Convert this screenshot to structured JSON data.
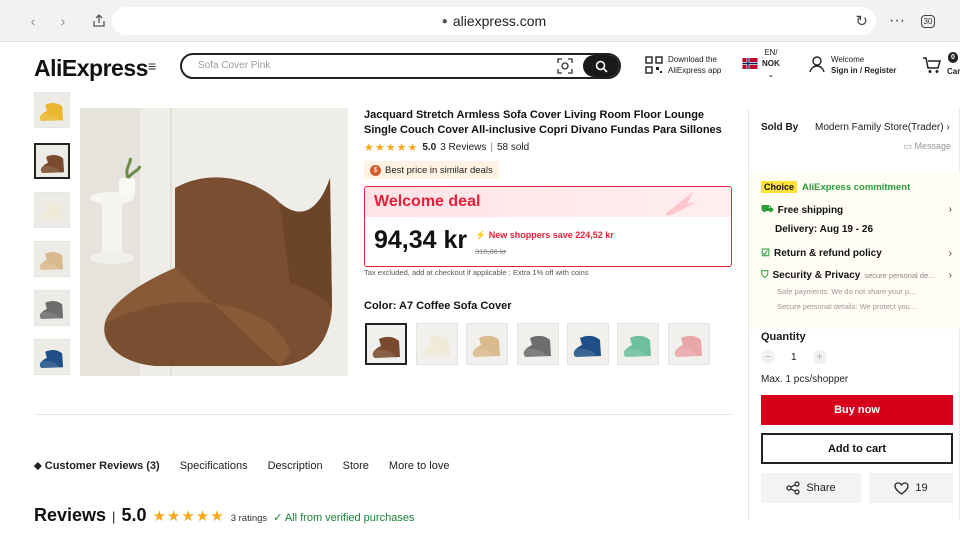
{
  "browser": {
    "url": "aliexpress.com",
    "tab_count": "30"
  },
  "header": {
    "logo_main": "AliExpress",
    "search_placeholder": "Sofa Cover Pink",
    "download_line1": "Download the",
    "download_line2": "AliExpress app",
    "lang": "EN/",
    "currency": "NOK",
    "welcome": "Welcome",
    "signin": "Sign in / Register",
    "cart_count": "0",
    "cart_label": "Car"
  },
  "product": {
    "title": "Jacquard Stretch Armless Sofa Cover Living Room Floor Lounge Single Couch Cover All-inclusive Copri Divano Fundas Para Sillones",
    "stars": "★★★★★",
    "rating": "5.0",
    "reviews_count": "3 Reviews",
    "separator": "|",
    "sold": "58 sold",
    "best_price": "Best price in similar deals",
    "deal_title": "Welcome deal",
    "price": "94,34 kr",
    "save_text": "New shoppers save 224,52 kr",
    "old_price": "318,86 kr",
    "tax_note": "Tax excluded, add at checkout if applicable ; Extra 1% off with coins",
    "color_label": "Color: ",
    "color_value": "A7 Coffee Sofa Cover",
    "swatches": [
      "#7a4a2e",
      "#efe9d8",
      "#d9b98e",
      "#6d6d6d",
      "#1f4f86",
      "#6dbfa0",
      "#e8a6a9"
    ]
  },
  "thumbnails": [
    "#e9b82f",
    "#7a4a2e",
    "#efe9d8",
    "#d9b98e",
    "#6d6d6d",
    "#1f4f86"
  ],
  "tabs": {
    "customer_reviews": "Customer Reviews (3)",
    "specifications": "Specifications",
    "description": "Description",
    "store": "Store",
    "more": "More to love"
  },
  "reviews_section": {
    "title": "Reviews",
    "sep": "|",
    "score": "5.0",
    "stars": "★★★★★",
    "ratings": "3 ratings",
    "verified": "All from verified purchases"
  },
  "sidebar": {
    "sold_by_label": "Sold By",
    "store_name": "Modern Family Store(Trader)",
    "message": "Message",
    "choice_tag": "Choice",
    "commitment": "AliExpress commitment",
    "free_shipping": "Free shipping",
    "delivery": "Delivery: Aug 19 - 26",
    "return_policy": "Return & refund policy",
    "security_title": "Security & Privacy",
    "security_sub": "secure personal de...",
    "safe_payments": "Safe payments: We do not share your p...",
    "secure_details": "Secure personal details: We protect you...",
    "quantity_label": "Quantity",
    "quantity_value": "1",
    "max_note": "Max. 1 pcs/shopper",
    "buy_now": "Buy now",
    "add_to_cart": "Add to cart",
    "share": "Share",
    "wishlist_count": "19"
  },
  "colors": {
    "brand_red": "#e8213a",
    "buy_red": "#d7001a",
    "star_gold": "#f7a81b",
    "green": "#2a9d3a"
  }
}
